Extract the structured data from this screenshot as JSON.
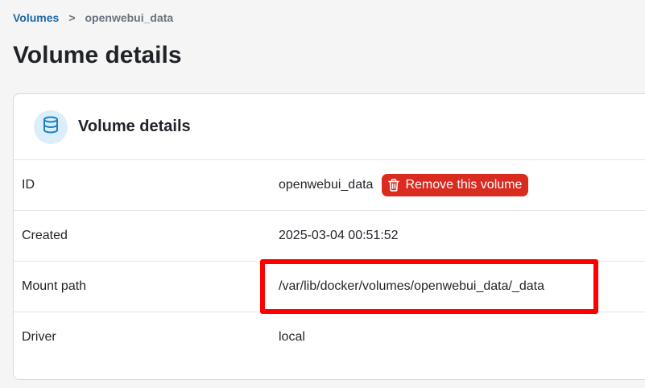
{
  "breadcrumb": {
    "parent_label": "Volumes",
    "separator": ">",
    "current_label": "openwebui_data"
  },
  "page": {
    "title": "Volume details"
  },
  "card": {
    "title": "Volume details",
    "icon": "database-icon",
    "rows": [
      {
        "label": "ID",
        "value": "openwebui_data"
      },
      {
        "label": "Created",
        "value": "2025-03-04 00:51:52"
      },
      {
        "label": "Mount path",
        "value": "/var/lib/docker/volumes/openwebui_data/_data"
      },
      {
        "label": "Driver",
        "value": "local"
      }
    ],
    "remove_button_label": "Remove this volume",
    "remove_button_icon": "trash-icon"
  },
  "colors": {
    "link": "#1c6aa5",
    "danger": "#d92b1f",
    "highlight": "#ff0000",
    "icon_bg": "#dbeefa",
    "icon_fg": "#1c7fc2"
  }
}
